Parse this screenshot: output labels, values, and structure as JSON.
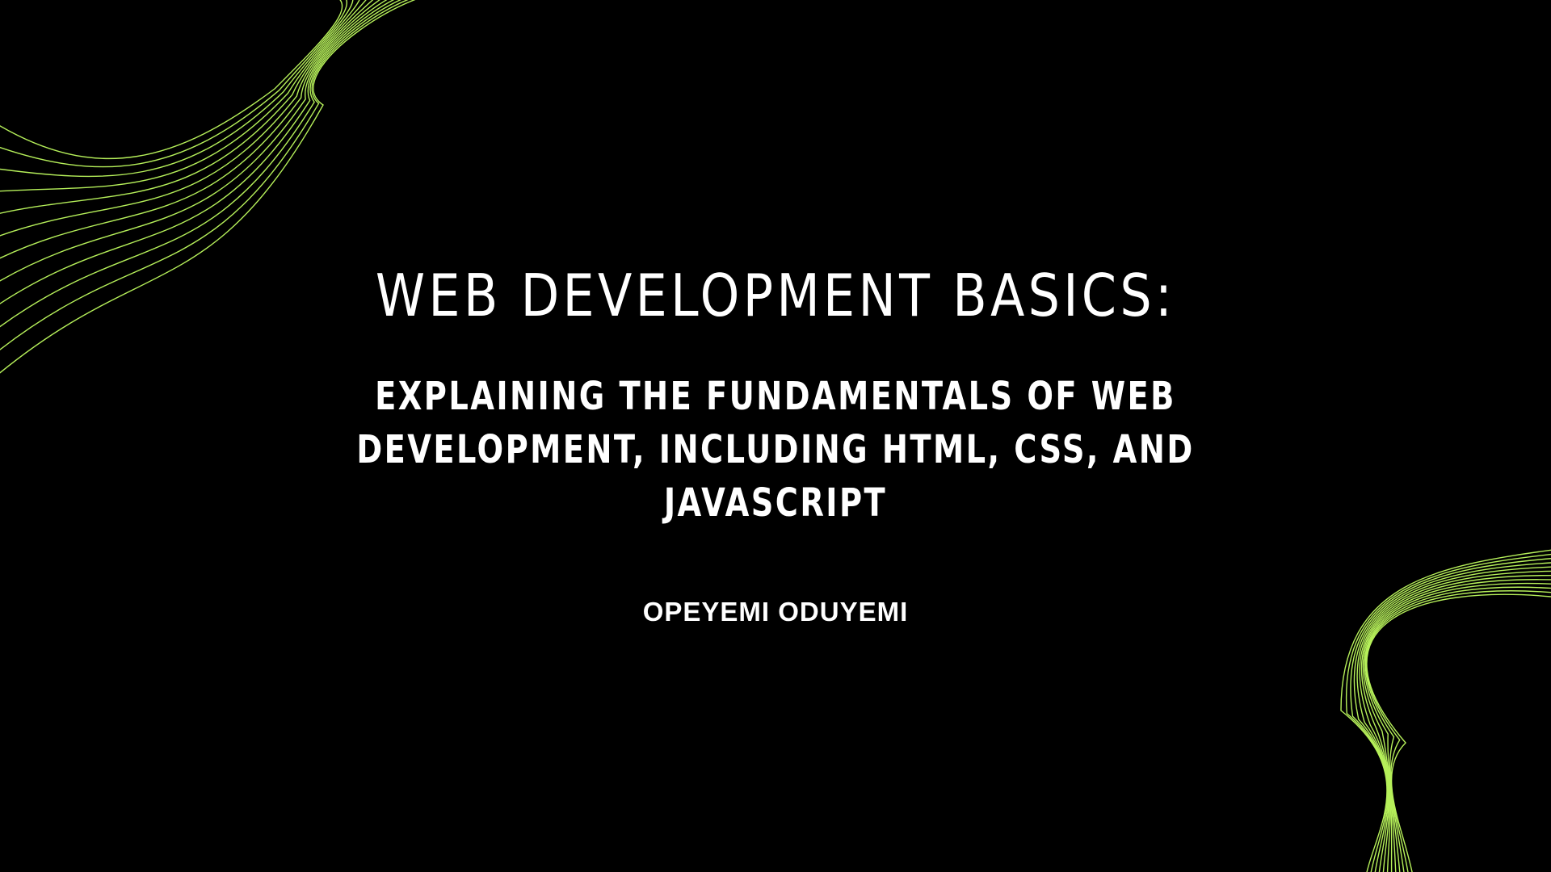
{
  "slide": {
    "title": "WEB DEVELOPMENT BASICS:",
    "subtitle": "EXPLAINING THE FUNDAMENTALS OF WEB DEVELOPMENT, INCLUDING HTML, CSS, AND JAVASCRIPT",
    "author": "OPEYEMI ODUYEMI"
  },
  "theme": {
    "background": "#000000",
    "text_color": "#ffffff",
    "accent_wave_color": "#b6f05a"
  },
  "decorations": {
    "top_left": "wave-lines-decoration",
    "bottom_right": "wave-lines-decoration"
  }
}
